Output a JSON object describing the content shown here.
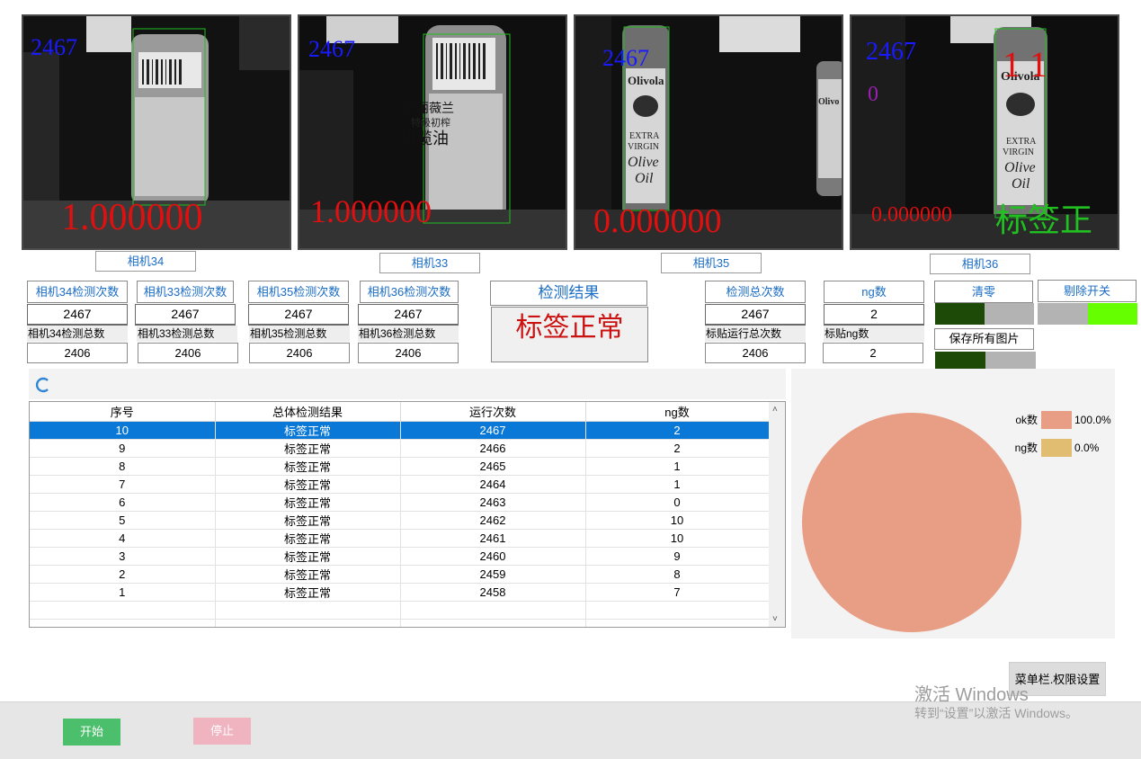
{
  "cameras": [
    {
      "id": "cam34",
      "label": "相机34",
      "count_overlay": "2467",
      "score": "1.000000"
    },
    {
      "id": "cam33",
      "label": "相机33",
      "count_overlay": "2467",
      "score": "1.000000",
      "label_text_top": "欧丽薇兰",
      "label_text_sub": "特级初榨",
      "label_text_big": "橄榄油"
    },
    {
      "id": "cam35",
      "label": "相机35",
      "count_overlay": "2467",
      "score": "0.000000",
      "brand": "Olivola",
      "brand2": "Olivo",
      "extra": "EXTRA",
      "virgin": "VIRGIN",
      "olive": "Olive",
      "oil": "Oil"
    },
    {
      "id": "cam36",
      "label": "相机36",
      "count_overlay": "2467",
      "score": "0.000000",
      "count_red": "1 1",
      "zero_purple": "0",
      "status_overlay": "标签正常",
      "brand": "Olivola",
      "extra": "EXTRA",
      "virgin": "VIRGIN",
      "olive": "Olive",
      "oil": "Oil"
    }
  ],
  "counters": [
    {
      "title": "相机34检测次数",
      "value": "2467",
      "total_label": "相机34检测总数",
      "total": "2406"
    },
    {
      "title": "相机33检测次数",
      "value": "2467",
      "total_label": "相机33检测总数",
      "total": "2406"
    },
    {
      "title": "相机35检测次数",
      "value": "2467",
      "total_label": "相机35检测总数",
      "total": "2406"
    },
    {
      "title": "相机36检测次数",
      "value": "2467",
      "total_label": "相机36检测总数",
      "total": "2406"
    }
  ],
  "result": {
    "title": "检测结果",
    "value": "标签正常",
    "color": "#cc1111"
  },
  "totals": {
    "detect_title": "检测总次数",
    "detect_value": "2467",
    "run_label": "标贴运行总次数",
    "run_value": "2406",
    "ng_title": "ng数",
    "ng_value": "2",
    "label_ng_label": "标贴ng数",
    "label_ng_value": "2"
  },
  "controls": {
    "clear": "清零",
    "reject_switch": "剔除开关",
    "save_all": "保存所有图片",
    "toggle_on_color": "#66ff00",
    "toggle_dark_color": "#1e4a08",
    "toggle_off_color": "#b3b3b3"
  },
  "refresh_icon": "refresh-icon",
  "table": {
    "columns": [
      "序号",
      "总体检测结果",
      "运行次数",
      "ng数"
    ],
    "rows": [
      [
        "10",
        "标签正常",
        "2467",
        "2"
      ],
      [
        "9",
        "标签正常",
        "2466",
        "2"
      ],
      [
        "8",
        "标签正常",
        "2465",
        "1"
      ],
      [
        "7",
        "标签正常",
        "2464",
        "1"
      ],
      [
        "6",
        "标签正常",
        "2463",
        "0"
      ],
      [
        "5",
        "标签正常",
        "2462",
        "10"
      ],
      [
        "4",
        "标签正常",
        "2461",
        "10"
      ],
      [
        "3",
        "标签正常",
        "2460",
        "9"
      ],
      [
        "2",
        "标签正常",
        "2459",
        "8"
      ],
      [
        "1",
        "标签正常",
        "2458",
        "7"
      ]
    ],
    "selected_row": 0,
    "selection_color": "#0a78d7"
  },
  "chart_data": {
    "type": "pie",
    "title": "",
    "series": [
      {
        "name": "ok数",
        "value": 100.0,
        "label": "100.0%",
        "color": "#e89e84"
      },
      {
        "name": "ng数",
        "value": 0.0,
        "label": "0.0%",
        "color": "#e0bd70"
      }
    ],
    "legend": "top-right"
  },
  "menu_button": "菜单栏.权限设置",
  "watermark": {
    "line1": "激活 Windows",
    "line2": "转到“设置”以激活 Windows。"
  },
  "footer": {
    "start": "开始",
    "stop": "停止",
    "start_color": "#4bbf6b",
    "stop_color": "#f0b3c0"
  }
}
